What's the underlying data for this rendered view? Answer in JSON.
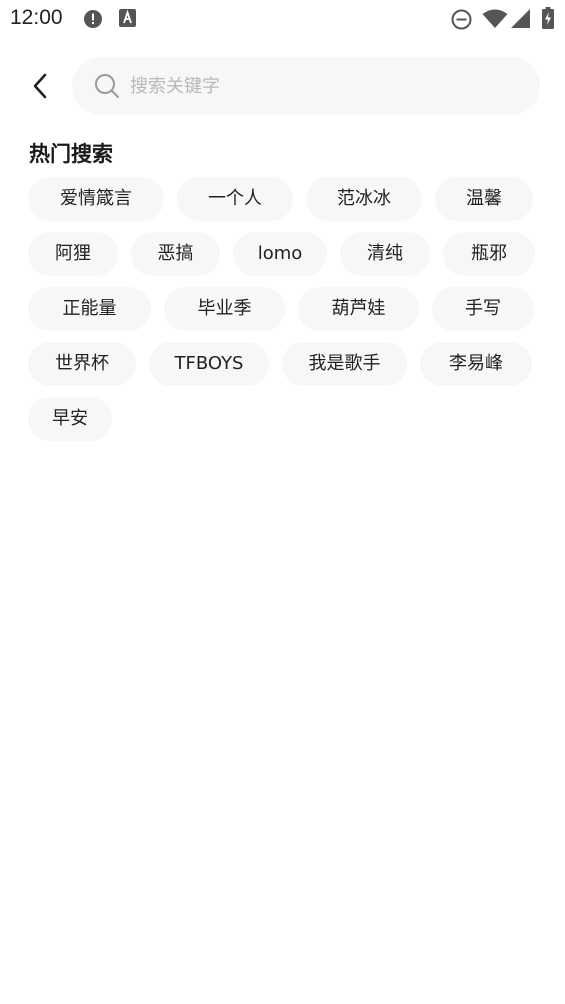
{
  "status_bar": {
    "time": "12:00"
  },
  "header": {
    "back_icon": "chevron-left-icon",
    "search": {
      "placeholder": "搜索关键字",
      "value": "",
      "icon": "search-icon"
    }
  },
  "hot_search": {
    "title": "热门搜索",
    "tags": [
      "爱情箴言",
      "一个人",
      "范冰冰",
      "温馨",
      "阿狸",
      "恶搞",
      "lomo",
      "清纯",
      "瓶邪",
      "正能量",
      "毕业季",
      "葫芦娃",
      "手写",
      "世界杯",
      "TFBOYS",
      "我是歌手",
      "李易峰",
      "早安"
    ]
  },
  "colors": {
    "background": "#ffffff",
    "tag_background": "#f7f7f7",
    "text": "#1a1a1a",
    "placeholder": "#b8b8b8"
  }
}
